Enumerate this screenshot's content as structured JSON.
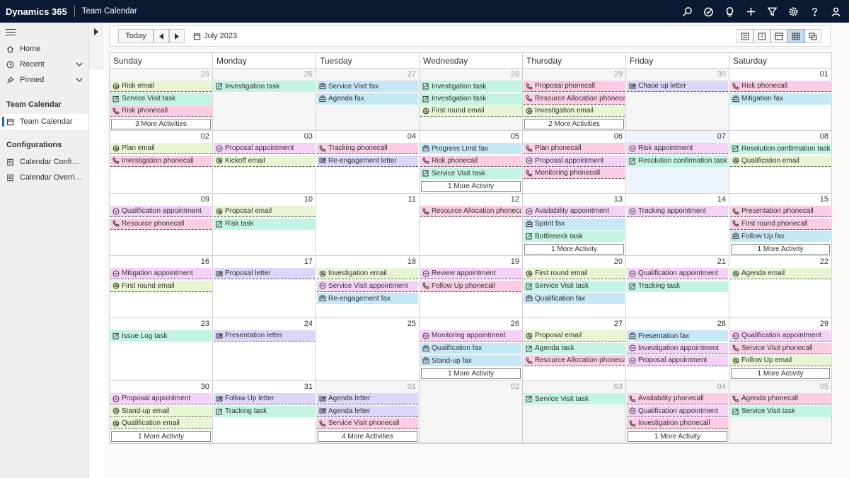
{
  "app": {
    "brand": "Dynamics 365",
    "title": "Team Calendar"
  },
  "topbar_icons": [
    "search-icon",
    "task-check-icon",
    "lightbulb-icon",
    "plus-icon",
    "filter-icon",
    "gear-icon",
    "help-icon",
    "user-icon"
  ],
  "sidebar": {
    "items": [
      {
        "label": "Home",
        "icon": "home-icon"
      },
      {
        "label": "Recent",
        "icon": "clock-icon"
      },
      {
        "label": "Pinned",
        "icon": "pin-icon"
      }
    ],
    "section_team": "Team Calendar",
    "team_item": "Team Calendar",
    "section_config": "Configurations",
    "config_items": [
      "Calendar Configurati...",
      "Calendar Overrides"
    ]
  },
  "toolbar": {
    "today_label": "Today",
    "current_month": "July 2023"
  },
  "calendar": {
    "days": [
      "Sunday",
      "Monday",
      "Tuesday",
      "Wednesday",
      "Thursday",
      "Friday",
      "Saturday"
    ],
    "weeks": [
      [
        {
          "num": "25",
          "other": true,
          "events": [
            [
              "email",
              "Risk email"
            ],
            [
              "task",
              "Service Visit task"
            ],
            [
              "phonecall",
              "Risk phonecall"
            ]
          ],
          "more": "3 More Activities"
        },
        {
          "num": "26",
          "other": true,
          "events": [
            [
              "task",
              "Investigation task"
            ]
          ]
        },
        {
          "num": "27",
          "other": true,
          "events": [
            [
              "fax",
              "Service Visit fax"
            ],
            [
              "fax",
              "Agenda fax"
            ]
          ]
        },
        {
          "num": "28",
          "other": true,
          "events": [
            [
              "task",
              "Investigation task"
            ],
            [
              "task",
              "Investigation task"
            ],
            [
              "email",
              "First round email"
            ]
          ]
        },
        {
          "num": "29",
          "other": true,
          "events": [
            [
              "phonecall",
              "Proposal phonecall"
            ],
            [
              "phonecall",
              "Resource Allocation phonecall"
            ],
            [
              "email",
              "Investigation email"
            ]
          ],
          "more": "2 More Activities"
        },
        {
          "num": "30",
          "other": true,
          "events": [
            [
              "letter",
              "Chase up letter"
            ]
          ]
        },
        {
          "num": "01",
          "events": [
            [
              "phonecall",
              "Risk phonecall"
            ],
            [
              "fax",
              "Mitigation fax"
            ]
          ]
        }
      ],
      [
        {
          "num": "02",
          "events": [
            [
              "email",
              "Plan email"
            ],
            [
              "phonecall",
              "Investigation phonecall"
            ]
          ]
        },
        {
          "num": "03",
          "events": [
            [
              "appointment",
              "Proposal appointment"
            ],
            [
              "email",
              "Kickoff email"
            ]
          ]
        },
        {
          "num": "04",
          "events": [
            [
              "phonecall",
              "Tracking phonecall"
            ],
            [
              "letter",
              "Re-engagement letter"
            ]
          ]
        },
        {
          "num": "05",
          "events": [
            [
              "fax",
              "Progress Limit fax"
            ],
            [
              "phonecall",
              "Risk phonecall"
            ],
            [
              "task",
              "Service Visit task"
            ]
          ],
          "more": "1 More Activity"
        },
        {
          "num": "06",
          "events": [
            [
              "phonecall",
              "Plan phonecall"
            ],
            [
              "appointment",
              "Proposal appointment"
            ],
            [
              "phonecall",
              "Monitoring phonecall"
            ]
          ]
        },
        {
          "num": "07",
          "today": true,
          "events": [
            [
              "appointment",
              "Risk appointment"
            ],
            [
              "task",
              "Resolution confirmation task"
            ]
          ]
        },
        {
          "num": "08",
          "events": [
            [
              "task",
              "Resolution confirmation task"
            ],
            [
              "email",
              "Qualification email"
            ]
          ]
        }
      ],
      [
        {
          "num": "09",
          "events": [
            [
              "appointment",
              "Qualification appointment"
            ],
            [
              "phonecall",
              "Resource phonecall"
            ]
          ]
        },
        {
          "num": "10",
          "events": [
            [
              "email",
              "Proposal email"
            ],
            [
              "task",
              "Risk task"
            ]
          ]
        },
        {
          "num": "11",
          "events": []
        },
        {
          "num": "12",
          "events": [
            [
              "phonecall",
              "Resource Allocation phonecall"
            ]
          ]
        },
        {
          "num": "13",
          "events": [
            [
              "appointment",
              "Availability appointment"
            ],
            [
              "fax",
              "Sprint fax"
            ],
            [
              "task",
              "Bottleneck task"
            ]
          ],
          "more": "1 More Activity"
        },
        {
          "num": "14",
          "events": [
            [
              "appointment",
              "Tracking appointment"
            ]
          ]
        },
        {
          "num": "15",
          "events": [
            [
              "phonecall",
              "Presentation phonecall"
            ],
            [
              "phonecall",
              "First round phonecall"
            ],
            [
              "fax",
              "Follow Up fax"
            ]
          ],
          "more": "1 More Activity"
        }
      ],
      [
        {
          "num": "16",
          "events": [
            [
              "appointment",
              "Mitigation appointment"
            ],
            [
              "email",
              "First round email"
            ]
          ]
        },
        {
          "num": "17",
          "events": [
            [
              "letter",
              "Proposal letter"
            ]
          ]
        },
        {
          "num": "18",
          "events": [
            [
              "email",
              "Investigation email"
            ],
            [
              "appointment",
              "Service Visit appointment"
            ],
            [
              "fax",
              "Re-engagement fax"
            ]
          ]
        },
        {
          "num": "19",
          "events": [
            [
              "appointment",
              "Review appointment"
            ],
            [
              "phonecall",
              "Follow Up phonecall"
            ]
          ]
        },
        {
          "num": "20",
          "events": [
            [
              "email",
              "First round email"
            ],
            [
              "task",
              "Service Visit task"
            ],
            [
              "fax",
              "Qualification fax"
            ]
          ]
        },
        {
          "num": "21",
          "events": [
            [
              "appointment",
              "Qualification appointment"
            ],
            [
              "task",
              "Tracking task"
            ]
          ]
        },
        {
          "num": "22",
          "events": [
            [
              "email",
              "Agenda email"
            ]
          ]
        }
      ],
      [
        {
          "num": "23",
          "events": [
            [
              "task",
              "Issue Log task"
            ]
          ]
        },
        {
          "num": "24",
          "events": [
            [
              "letter",
              "Presentation letter"
            ]
          ]
        },
        {
          "num": "25",
          "events": []
        },
        {
          "num": "26",
          "events": [
            [
              "appointment",
              "Monitoring appointment"
            ],
            [
              "fax",
              "Qualification fax"
            ],
            [
              "fax",
              "Stand-up fax"
            ]
          ],
          "more": "1 More Activity"
        },
        {
          "num": "27",
          "events": [
            [
              "email",
              "Proposal email"
            ],
            [
              "task",
              "Agenda task"
            ],
            [
              "phonecall",
              "Resource Allocation phonecall"
            ]
          ]
        },
        {
          "num": "28",
          "events": [
            [
              "fax",
              "Presentation fax"
            ],
            [
              "appointment",
              "Investigation appointment"
            ],
            [
              "appointment",
              "Proposal appointment"
            ]
          ]
        },
        {
          "num": "29",
          "events": [
            [
              "appointment",
              "Qualification appointment"
            ],
            [
              "phonecall",
              "Service Visit phonecall"
            ],
            [
              "email",
              "Follow Up email"
            ]
          ],
          "more": "1 More Activity"
        }
      ],
      [
        {
          "num": "30",
          "events": [
            [
              "appointment",
              "Proposal appointment"
            ],
            [
              "email",
              "Stand-up email"
            ],
            [
              "email",
              "Qualification email"
            ]
          ],
          "more": "1 More Activity"
        },
        {
          "num": "31",
          "events": [
            [
              "letter",
              "Follow Up letter"
            ],
            [
              "task",
              "Tracking task"
            ]
          ]
        },
        {
          "num": "01",
          "other": true,
          "events": [
            [
              "letter",
              "Agenda letter"
            ],
            [
              "letter",
              "Agenda letter"
            ],
            [
              "phonecall",
              "Service Visit phonecall"
            ]
          ],
          "more": "4 More Activities"
        },
        {
          "num": "02",
          "other": true,
          "events": []
        },
        {
          "num": "03",
          "other": true,
          "events": [
            [
              "task",
              "Service Visit task"
            ]
          ]
        },
        {
          "num": "04",
          "other": true,
          "events": [
            [
              "phonecall",
              "Availability phonecall"
            ],
            [
              "appointment",
              "Qualification appointment"
            ],
            [
              "phonecall",
              "Investigation phonecall"
            ]
          ],
          "more": "1 More Activity"
        },
        {
          "num": "05",
          "other": true,
          "events": [
            [
              "phonecall",
              "Agenda phonecall"
            ],
            [
              "task",
              "Service Visit task"
            ]
          ]
        }
      ]
    ]
  },
  "colors": {
    "topbar": "#0b1a33",
    "email": "#e8f5d3",
    "task": "#c3f3e2",
    "fax": "#c5e7f8",
    "phonecall": "#fbcde4",
    "appointment": "#f6d1f7",
    "letter": "#ddd6f8"
  }
}
